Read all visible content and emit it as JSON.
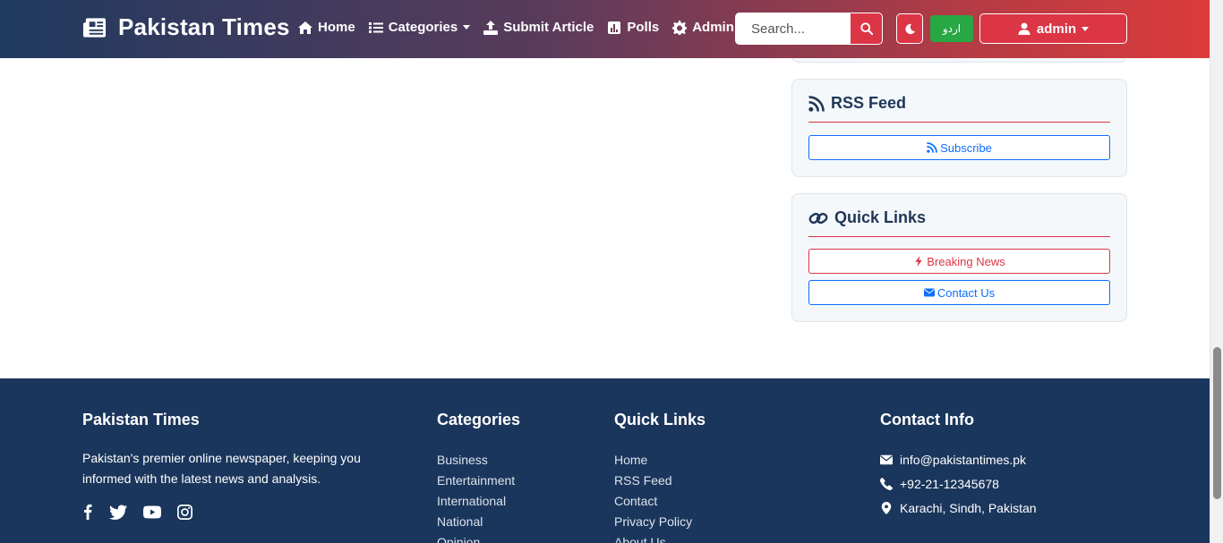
{
  "navbar": {
    "brand": "Pakistan Times",
    "items": [
      {
        "label": "Home",
        "icon": "home-icon"
      },
      {
        "label": "Categories",
        "icon": "list-icon"
      },
      {
        "label": "Submit Article",
        "icon": "upload-icon"
      },
      {
        "label": "Polls",
        "icon": "poll-icon"
      },
      {
        "label": "Admin",
        "icon": "gear-icon"
      }
    ],
    "search_placeholder": "Search...",
    "language_label": "اردو",
    "user_label": "admin",
    "colors": {
      "gradient_start": "#1f3a5f",
      "gradient_end": "#dc3b3b",
      "accent_red": "#dc3545",
      "accent_green": "#28a745"
    }
  },
  "sidebar": {
    "rss": {
      "title": "RSS Feed",
      "subscribe_label": "Subscribe"
    },
    "quick_links": {
      "title": "Quick Links",
      "breaking_label": "Breaking News",
      "contact_label": "Contact Us"
    }
  },
  "footer": {
    "about": {
      "title": "Pakistan Times",
      "description": "Pakistan's premier online newspaper, keeping you informed with the latest news and analysis.",
      "social": [
        "facebook-icon",
        "twitter-icon",
        "youtube-icon",
        "instagram-icon"
      ]
    },
    "categories": {
      "title": "Categories",
      "items": [
        "Business",
        "Entertainment",
        "International",
        "National",
        "Opinion"
      ]
    },
    "quick_links": {
      "title": "Quick Links",
      "items": [
        "Home",
        "RSS Feed",
        "Contact",
        "Privacy Policy",
        "About Us"
      ]
    },
    "contact": {
      "title": "Contact Info",
      "email": "info@pakistantimes.pk",
      "phone": "+92-21-12345678",
      "address": "Karachi, Sindh, Pakistan"
    }
  }
}
